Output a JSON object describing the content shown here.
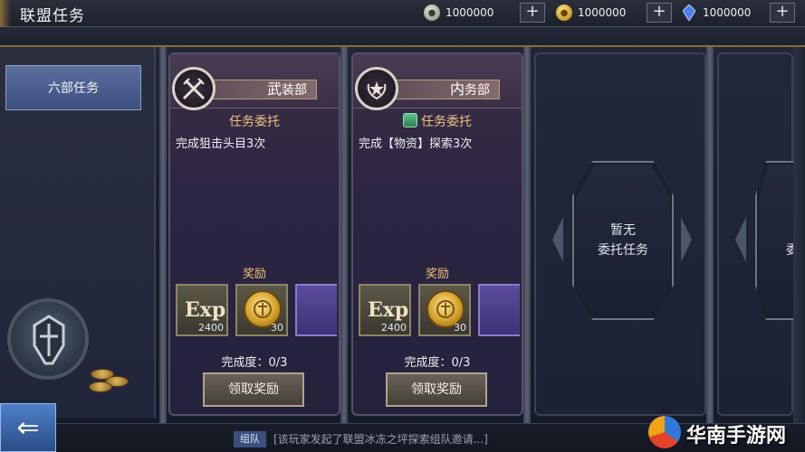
{
  "header": {
    "title": "联盟任务",
    "currencies": [
      {
        "icon": "silver-coin-icon",
        "value": "1000000"
      },
      {
        "icon": "gold-coin-icon",
        "value": "1000000"
      },
      {
        "icon": "blue-gem-icon",
        "value": "1000000"
      }
    ],
    "plus_label": "+"
  },
  "sidebar": {
    "tabs": [
      {
        "label": "六部任务",
        "selected": true
      }
    ],
    "back_label": "⇐"
  },
  "cards": [
    {
      "dept_first": "武",
      "dept_rest": "装部",
      "task_type": "任务委托",
      "desc": "完成狙击头目3次",
      "reward_title": "奖励",
      "rewards": [
        {
          "type": "exp",
          "label": "Exp",
          "count": "2400"
        },
        {
          "type": "gold-coin",
          "count": "30"
        }
      ],
      "progress": "完成度：0/3",
      "claim_label": "领取奖励"
    },
    {
      "dept_first": "内",
      "dept_rest": "务部",
      "task_type": "任务委托",
      "desc": "完成【物资】探索3次",
      "reward_title": "奖励",
      "rewards": [
        {
          "type": "exp",
          "label": "Exp",
          "count": "2400"
        },
        {
          "type": "gold-coin",
          "count": "30"
        }
      ],
      "progress": "完成度：0/3",
      "claim_label": "领取奖励"
    }
  ],
  "empty_slot": {
    "line1": "暂无",
    "line2": "委托任务"
  },
  "chat": {
    "tag": "组队",
    "text": "[该玩家发起了联盟冰冻之坪探索组队邀请...]"
  },
  "watermark": {
    "text": "华南手游网"
  }
}
